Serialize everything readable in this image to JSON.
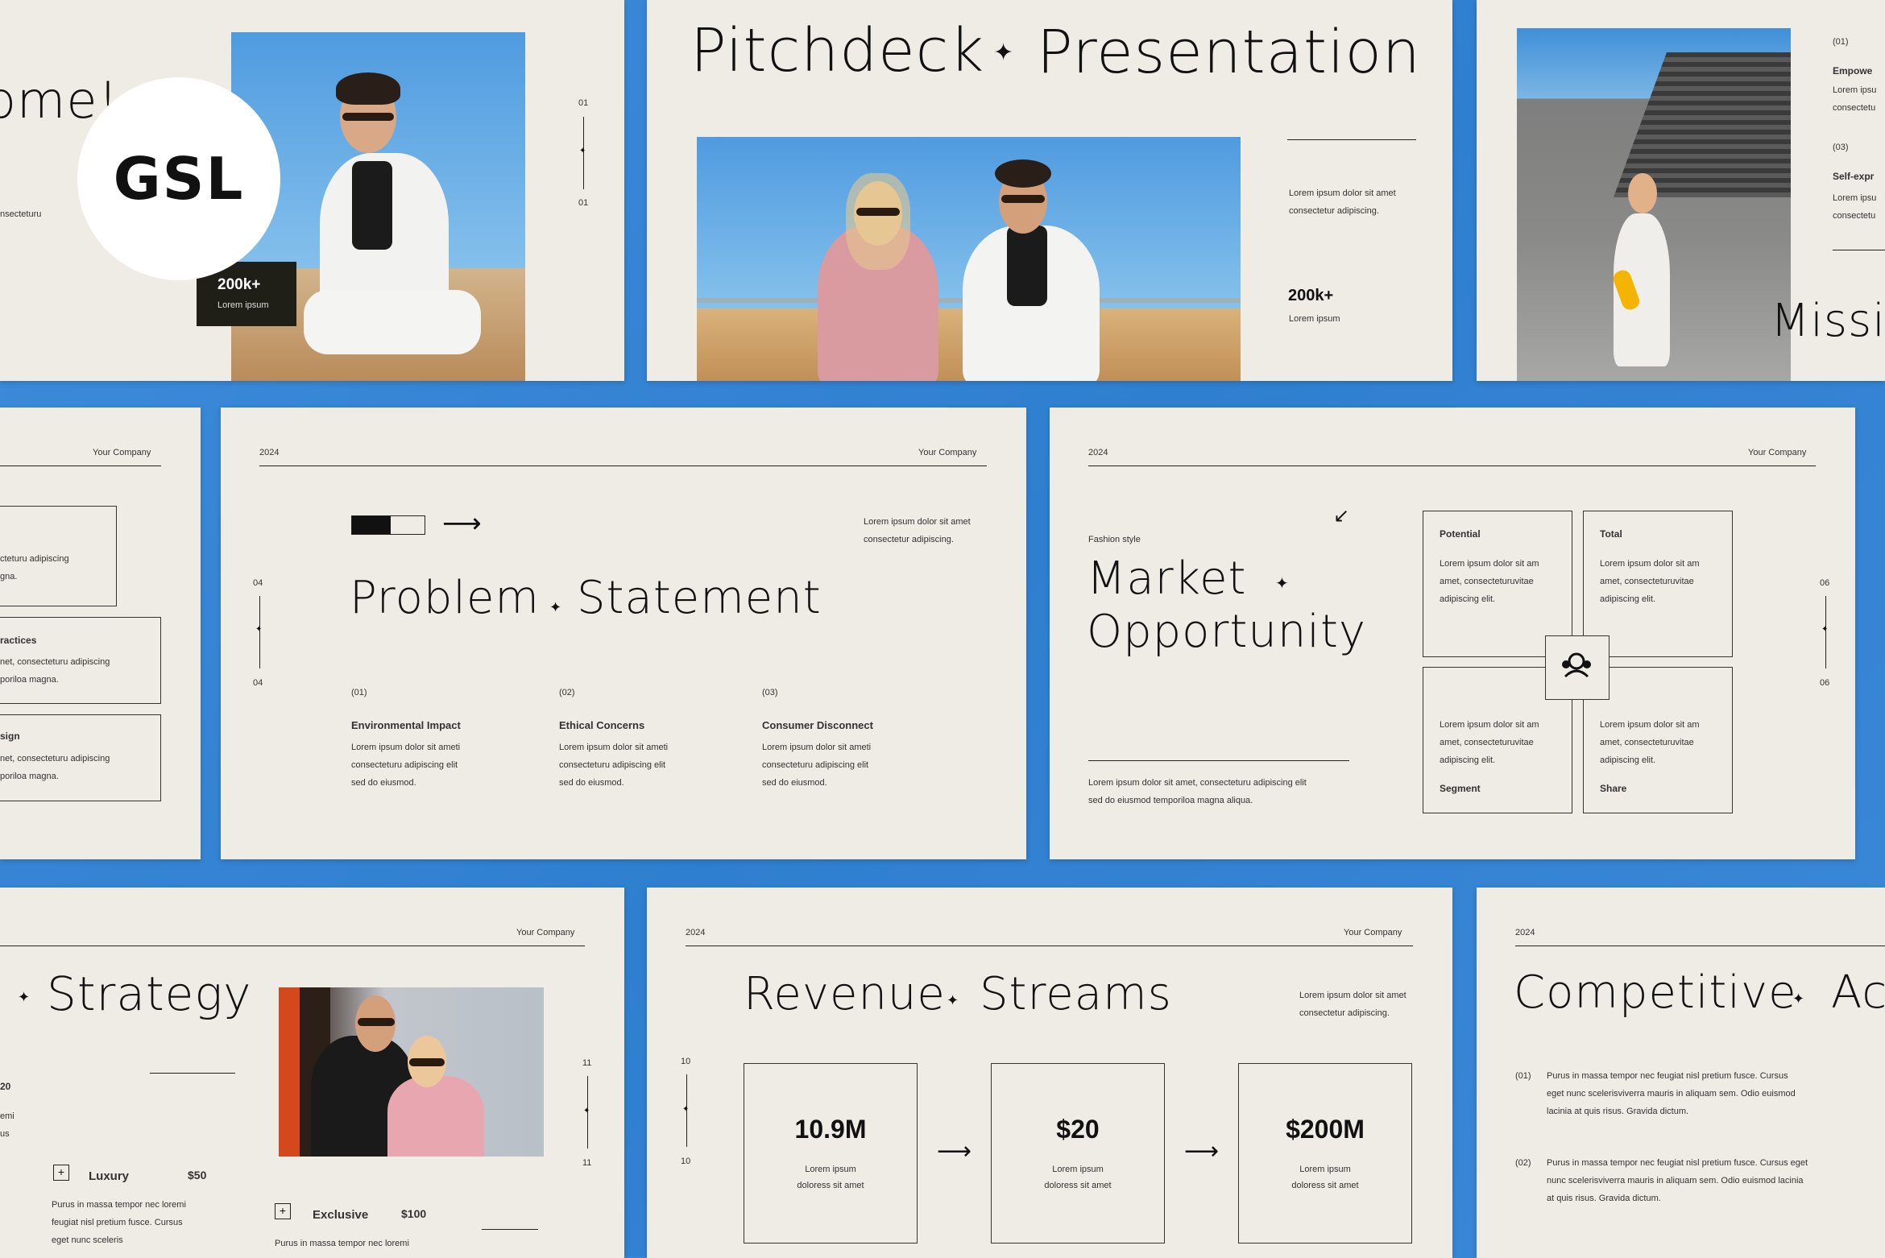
{
  "logo": {
    "text": "GSL"
  },
  "common": {
    "company": "Your Company",
    "year": "2024"
  },
  "s1": {
    "title_fragment": "ome!",
    "body_fragment": "nsecteturu",
    "stat_value": "200k+",
    "stat_label": "Lorem ipsum",
    "page_top": "01",
    "page_bottom": "01"
  },
  "s2": {
    "title_left": "Pitchdeck",
    "title_right": "Presentation",
    "body_line1": "Lorem ipsum dolor sit amet",
    "body_line2": "consectetur  adipiscing.",
    "stat_value": "200k+",
    "stat_label": "Lorem ipsum"
  },
  "s3": {
    "num1": "(01)",
    "head1": "Empowe",
    "l1a": "Lorem ipsu",
    "l1b": "consectetu",
    "num3": "(03)",
    "head3": "Self-expr",
    "l3a": "Lorem ipsu",
    "l3b": "consectetu",
    "title_fragment": "Missic"
  },
  "s4": {
    "company": "Your Company",
    "b1a": "cteturu adipiscing",
    "b1b": "gna.",
    "h2": "ractices",
    "b2a": "net, consecteturu adipiscing",
    "b2b": "poriloa magna.",
    "h3": "sign",
    "b3a": "net, consecteturu adipiscing",
    "b3b": "poriloa magna."
  },
  "s5": {
    "year": "2024",
    "company": "Your Company",
    "intro1": "Lorem ipsum dolor sit amet",
    "intro2": "consectetur  adipiscing.",
    "title_left": "Problem",
    "title_right": "Statement",
    "page_top": "04",
    "page_bottom": "04",
    "items": [
      {
        "num": "(01)",
        "head": "Environmental Impact",
        "l1": "Lorem ipsum dolor sit ameti",
        "l2": "consecteturu adipiscing elit",
        "l3": "sed do eiusmod."
      },
      {
        "num": "(02)",
        "head": "Ethical Concerns",
        "l1": "Lorem ipsum dolor sit ameti",
        "l2": "consecteturu adipiscing elit",
        "l3": "sed do eiusmod."
      },
      {
        "num": "(03)",
        "head": "Consumer Disconnect",
        "l1": "Lorem ipsum dolor sit ameti",
        "l2": "consecteturu adipiscing elit",
        "l3": "sed do eiusmod."
      }
    ]
  },
  "s6": {
    "year": "2024",
    "company": "Your Company",
    "kicker": "Fashion style",
    "title1": "Market",
    "title2": "Opportunity",
    "foot1": "Lorem ipsum dolor sit amet, consecteturu adipiscing elit",
    "foot2": "sed do eiusmod temporiloa magna aliqua.",
    "page_top": "06",
    "page_bottom": "06",
    "cells": [
      {
        "label": "Potential",
        "l1": "Lorem ipsum dolor sit am",
        "l2": "amet, consecteturuvitae",
        "l3": "adipiscing elit."
      },
      {
        "label": "Total",
        "l1": "Lorem ipsum dolor sit am",
        "l2": "amet, consecteturuvitae",
        "l3": "adipiscing elit."
      },
      {
        "label": "Segment",
        "l1": "Lorem ipsum dolor sit am",
        "l2": "amet, consecteturuvitae",
        "l3": "adipiscing elit."
      },
      {
        "label": "Share",
        "l1": "Lorem ipsum dolor sit am",
        "l2": "amet, consecteturuvitae",
        "l3": "adipiscing elit."
      }
    ]
  },
  "s7": {
    "company": "Your Company",
    "title": "Strategy",
    "frag1": "20",
    "frag2": "emi",
    "frag3": "us",
    "page_top": "11",
    "page_bottom": "11",
    "plans": [
      {
        "name": "Luxury",
        "price": "$50",
        "l1": "Purus in massa tempor nec loremi",
        "l2": "feugiat nisl pretium fusce. Cursus",
        "l3": "eget nunc sceleris"
      },
      {
        "name": "Exclusive",
        "price": "$100",
        "l1": "Purus in massa tempor nec loremi"
      }
    ]
  },
  "s8": {
    "year": "2024",
    "company": "Your Company",
    "title_left": "Revenue",
    "title_right": "Streams",
    "intro1": "Lorem ipsum dolor sit amet",
    "intro2": "consectetur adipiscing.",
    "page_top": "10",
    "page_bottom": "10",
    "cards": [
      {
        "value": "10.9M",
        "l1": "Lorem ipsum",
        "l2": "doloress sit amet"
      },
      {
        "value": "$20",
        "l1": "Lorem ipsum",
        "l2": "doloress sit amet"
      },
      {
        "value": "$200M",
        "l1": "Lorem ipsum",
        "l2": "doloress sit amet"
      }
    ]
  },
  "s9": {
    "year": "2024",
    "title_left": "Competitive",
    "title_right": "Ac",
    "items": [
      {
        "num": "(01)",
        "l1": "Purus in massa tempor nec feugiat nisl pretium fusce. Cursus",
        "l2": "eget nunc scelerisviverra mauris in aliquam sem. Odio euismod",
        "l3": "lacinia at quis risus. Gravida dictum."
      },
      {
        "num": "(02)",
        "l1": "Purus in massa tempor nec feugiat nisl pretium fusce. Cursus eget",
        "l2": "nunc scelerisviverra mauris in aliquam sem. Odio euismod lacinia",
        "l3": "at quis risus. Gravida dictum."
      }
    ]
  },
  "icons": {
    "star": "four-point-star",
    "arrow": "arrow-right",
    "team": "team-icon"
  }
}
